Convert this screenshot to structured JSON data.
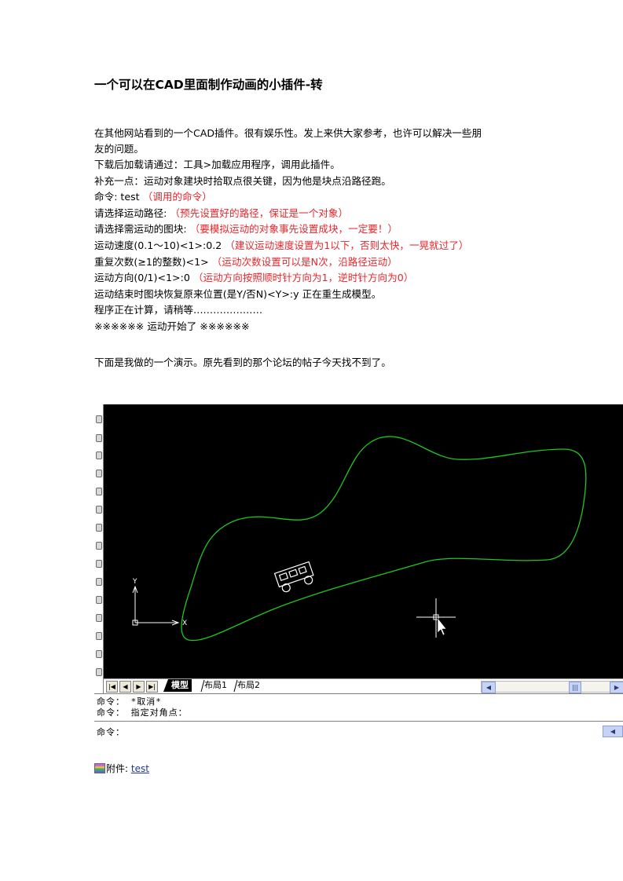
{
  "title": "一个可以在CAD里面制作动画的小插件-转",
  "intro": [
    "在其他网站看到的一个CAD插件。很有娱乐性。发上来供大家参考，也许可以解决一些朋",
    "友的问题。"
  ],
  "lines": [
    {
      "text": "下载后加载请通过：工具>加载应用程序，调用此插件。",
      "note": ""
    },
    {
      "text": "补充一点：运动对象建块时拾取点很关键，因为他是块点沿路径跑。",
      "note": ""
    },
    {
      "text": "命令: test  ",
      "note": "（调用的命令）"
    },
    {
      "text": "请选择运动路径: ",
      "note": "（预先设置好的路径，保证是一个对象）"
    },
    {
      "text": "请选择需运动的图块: ",
      "note": "（要模拟运动的对象事先设置成块，一定要！）"
    },
    {
      "text": "运动速度(0.1～10)<1>:0.2  ",
      "note": "（建议运动速度设置为1以下，否则太快，一晃就过了）"
    },
    {
      "text": "重复次数(≥1的整数)<1>  ",
      "note": "（运动次数设置可以是N次，沿路径运动）"
    },
    {
      "text": "运动方向(0/1)<1>:0  ",
      "note": "（运动方向按照顺时针方向为1，逆时针方向为0）"
    },
    {
      "text": "运动结束时图块恢复原来位置(是Y/否N)<Y>:y  正在重生成模型。",
      "note": ""
    },
    {
      "text": "   程序正在计算，请稍等…………………",
      "note": ""
    },
    {
      "text": "※※※※※※   运动开始了   ※※※※※※",
      "note": ""
    }
  ],
  "demo_text": "下面是我做的一个演示。原先看到的那个论坛的帖子今天找不到了。",
  "cad": {
    "tabs": {
      "model": "模型",
      "layout1": "布局1",
      "layout2": "布局2"
    },
    "axis": {
      "x": "X",
      "y": "Y"
    },
    "command_lines": [
      "命令：  *取消*",
      "命令：  指定对角点：",
      "命令："
    ],
    "colors": {
      "background": "#000000",
      "path": "#1ec81e",
      "block": "#ffffff"
    }
  },
  "attachment": {
    "label": "附件: ",
    "link": "test"
  }
}
